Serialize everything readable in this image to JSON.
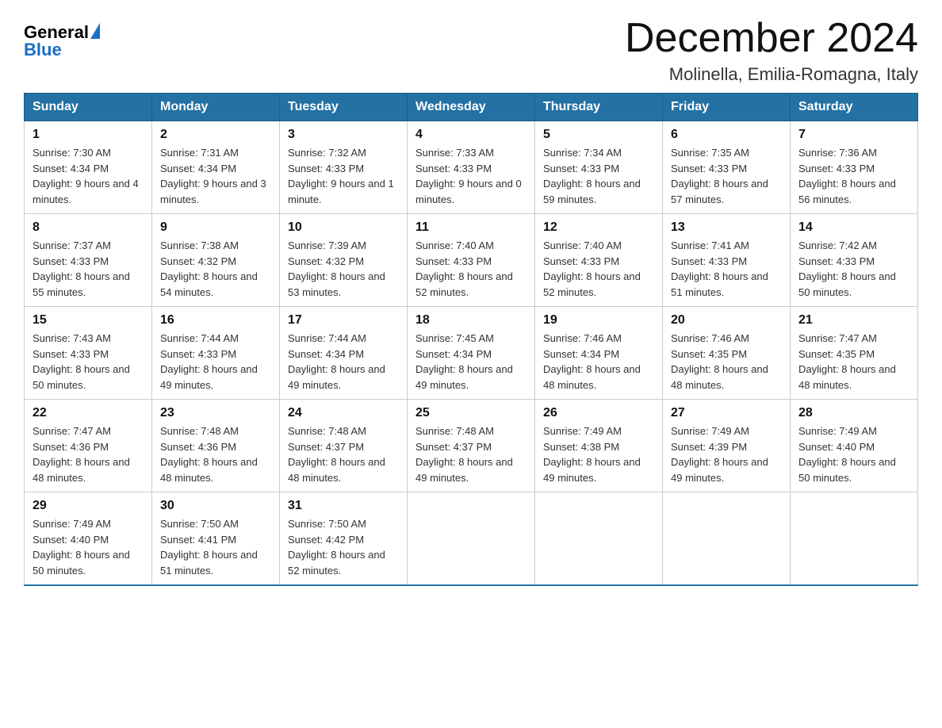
{
  "logo": {
    "general": "General",
    "blue": "Blue",
    "alt": "GeneralBlue logo"
  },
  "title": {
    "month_year": "December 2024",
    "location": "Molinella, Emilia-Romagna, Italy"
  },
  "weekdays": [
    "Sunday",
    "Monday",
    "Tuesday",
    "Wednesday",
    "Thursday",
    "Friday",
    "Saturday"
  ],
  "weeks": [
    [
      {
        "day": "1",
        "sunrise": "Sunrise: 7:30 AM",
        "sunset": "Sunset: 4:34 PM",
        "daylight": "Daylight: 9 hours and 4 minutes."
      },
      {
        "day": "2",
        "sunrise": "Sunrise: 7:31 AM",
        "sunset": "Sunset: 4:34 PM",
        "daylight": "Daylight: 9 hours and 3 minutes."
      },
      {
        "day": "3",
        "sunrise": "Sunrise: 7:32 AM",
        "sunset": "Sunset: 4:33 PM",
        "daylight": "Daylight: 9 hours and 1 minute."
      },
      {
        "day": "4",
        "sunrise": "Sunrise: 7:33 AM",
        "sunset": "Sunset: 4:33 PM",
        "daylight": "Daylight: 9 hours and 0 minutes."
      },
      {
        "day": "5",
        "sunrise": "Sunrise: 7:34 AM",
        "sunset": "Sunset: 4:33 PM",
        "daylight": "Daylight: 8 hours and 59 minutes."
      },
      {
        "day": "6",
        "sunrise": "Sunrise: 7:35 AM",
        "sunset": "Sunset: 4:33 PM",
        "daylight": "Daylight: 8 hours and 57 minutes."
      },
      {
        "day": "7",
        "sunrise": "Sunrise: 7:36 AM",
        "sunset": "Sunset: 4:33 PM",
        "daylight": "Daylight: 8 hours and 56 minutes."
      }
    ],
    [
      {
        "day": "8",
        "sunrise": "Sunrise: 7:37 AM",
        "sunset": "Sunset: 4:33 PM",
        "daylight": "Daylight: 8 hours and 55 minutes."
      },
      {
        "day": "9",
        "sunrise": "Sunrise: 7:38 AM",
        "sunset": "Sunset: 4:32 PM",
        "daylight": "Daylight: 8 hours and 54 minutes."
      },
      {
        "day": "10",
        "sunrise": "Sunrise: 7:39 AM",
        "sunset": "Sunset: 4:32 PM",
        "daylight": "Daylight: 8 hours and 53 minutes."
      },
      {
        "day": "11",
        "sunrise": "Sunrise: 7:40 AM",
        "sunset": "Sunset: 4:33 PM",
        "daylight": "Daylight: 8 hours and 52 minutes."
      },
      {
        "day": "12",
        "sunrise": "Sunrise: 7:40 AM",
        "sunset": "Sunset: 4:33 PM",
        "daylight": "Daylight: 8 hours and 52 minutes."
      },
      {
        "day": "13",
        "sunrise": "Sunrise: 7:41 AM",
        "sunset": "Sunset: 4:33 PM",
        "daylight": "Daylight: 8 hours and 51 minutes."
      },
      {
        "day": "14",
        "sunrise": "Sunrise: 7:42 AM",
        "sunset": "Sunset: 4:33 PM",
        "daylight": "Daylight: 8 hours and 50 minutes."
      }
    ],
    [
      {
        "day": "15",
        "sunrise": "Sunrise: 7:43 AM",
        "sunset": "Sunset: 4:33 PM",
        "daylight": "Daylight: 8 hours and 50 minutes."
      },
      {
        "day": "16",
        "sunrise": "Sunrise: 7:44 AM",
        "sunset": "Sunset: 4:33 PM",
        "daylight": "Daylight: 8 hours and 49 minutes."
      },
      {
        "day": "17",
        "sunrise": "Sunrise: 7:44 AM",
        "sunset": "Sunset: 4:34 PM",
        "daylight": "Daylight: 8 hours and 49 minutes."
      },
      {
        "day": "18",
        "sunrise": "Sunrise: 7:45 AM",
        "sunset": "Sunset: 4:34 PM",
        "daylight": "Daylight: 8 hours and 49 minutes."
      },
      {
        "day": "19",
        "sunrise": "Sunrise: 7:46 AM",
        "sunset": "Sunset: 4:34 PM",
        "daylight": "Daylight: 8 hours and 48 minutes."
      },
      {
        "day": "20",
        "sunrise": "Sunrise: 7:46 AM",
        "sunset": "Sunset: 4:35 PM",
        "daylight": "Daylight: 8 hours and 48 minutes."
      },
      {
        "day": "21",
        "sunrise": "Sunrise: 7:47 AM",
        "sunset": "Sunset: 4:35 PM",
        "daylight": "Daylight: 8 hours and 48 minutes."
      }
    ],
    [
      {
        "day": "22",
        "sunrise": "Sunrise: 7:47 AM",
        "sunset": "Sunset: 4:36 PM",
        "daylight": "Daylight: 8 hours and 48 minutes."
      },
      {
        "day": "23",
        "sunrise": "Sunrise: 7:48 AM",
        "sunset": "Sunset: 4:36 PM",
        "daylight": "Daylight: 8 hours and 48 minutes."
      },
      {
        "day": "24",
        "sunrise": "Sunrise: 7:48 AM",
        "sunset": "Sunset: 4:37 PM",
        "daylight": "Daylight: 8 hours and 48 minutes."
      },
      {
        "day": "25",
        "sunrise": "Sunrise: 7:48 AM",
        "sunset": "Sunset: 4:37 PM",
        "daylight": "Daylight: 8 hours and 49 minutes."
      },
      {
        "day": "26",
        "sunrise": "Sunrise: 7:49 AM",
        "sunset": "Sunset: 4:38 PM",
        "daylight": "Daylight: 8 hours and 49 minutes."
      },
      {
        "day": "27",
        "sunrise": "Sunrise: 7:49 AM",
        "sunset": "Sunset: 4:39 PM",
        "daylight": "Daylight: 8 hours and 49 minutes."
      },
      {
        "day": "28",
        "sunrise": "Sunrise: 7:49 AM",
        "sunset": "Sunset: 4:40 PM",
        "daylight": "Daylight: 8 hours and 50 minutes."
      }
    ],
    [
      {
        "day": "29",
        "sunrise": "Sunrise: 7:49 AM",
        "sunset": "Sunset: 4:40 PM",
        "daylight": "Daylight: 8 hours and 50 minutes."
      },
      {
        "day": "30",
        "sunrise": "Sunrise: 7:50 AM",
        "sunset": "Sunset: 4:41 PM",
        "daylight": "Daylight: 8 hours and 51 minutes."
      },
      {
        "day": "31",
        "sunrise": "Sunrise: 7:50 AM",
        "sunset": "Sunset: 4:42 PM",
        "daylight": "Daylight: 8 hours and 52 minutes."
      },
      null,
      null,
      null,
      null
    ]
  ]
}
